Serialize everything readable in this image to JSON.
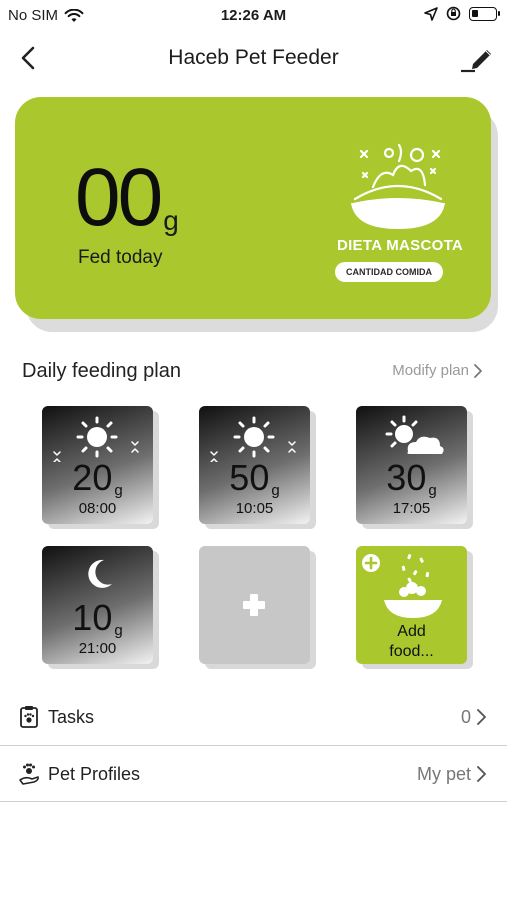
{
  "status_bar": {
    "carrier": "No SIM",
    "time": "12:26 AM"
  },
  "nav": {
    "title": "Haceb Pet Feeder",
    "back_icon": "chevron-left-icon",
    "edit_icon": "pencil-icon"
  },
  "summary": {
    "fed_today_value": "00",
    "fed_today_unit": "g",
    "fed_today_label": "Fed today",
    "diet_title": "DIETA MASCOTA",
    "diet_subtitle": "CANTIDAD COMIDA"
  },
  "feeding_plan": {
    "title": "Daily feeding plan",
    "modify_label": "Modify plan",
    "meals": [
      {
        "amount": "20",
        "unit": "g",
        "time": "08:00",
        "icon": "sun-sparkle-icon"
      },
      {
        "amount": "50",
        "unit": "g",
        "time": "10:05",
        "icon": "sun-sparkle-icon"
      },
      {
        "amount": "30",
        "unit": "g",
        "time": "17:05",
        "icon": "sun-cloud-icon"
      },
      {
        "amount": "10",
        "unit": "g",
        "time": "21:00",
        "icon": "moon-icon"
      }
    ],
    "add_food_label_1": "Add",
    "add_food_label_2": "food..."
  },
  "menu": {
    "tasks_label": "Tasks",
    "tasks_value": "0",
    "pet_profiles_label": "Pet Profiles",
    "pet_profiles_value": "My pet"
  },
  "colors": {
    "accent_green": "#aac72e",
    "tile_empty": "#c7c7c7"
  }
}
